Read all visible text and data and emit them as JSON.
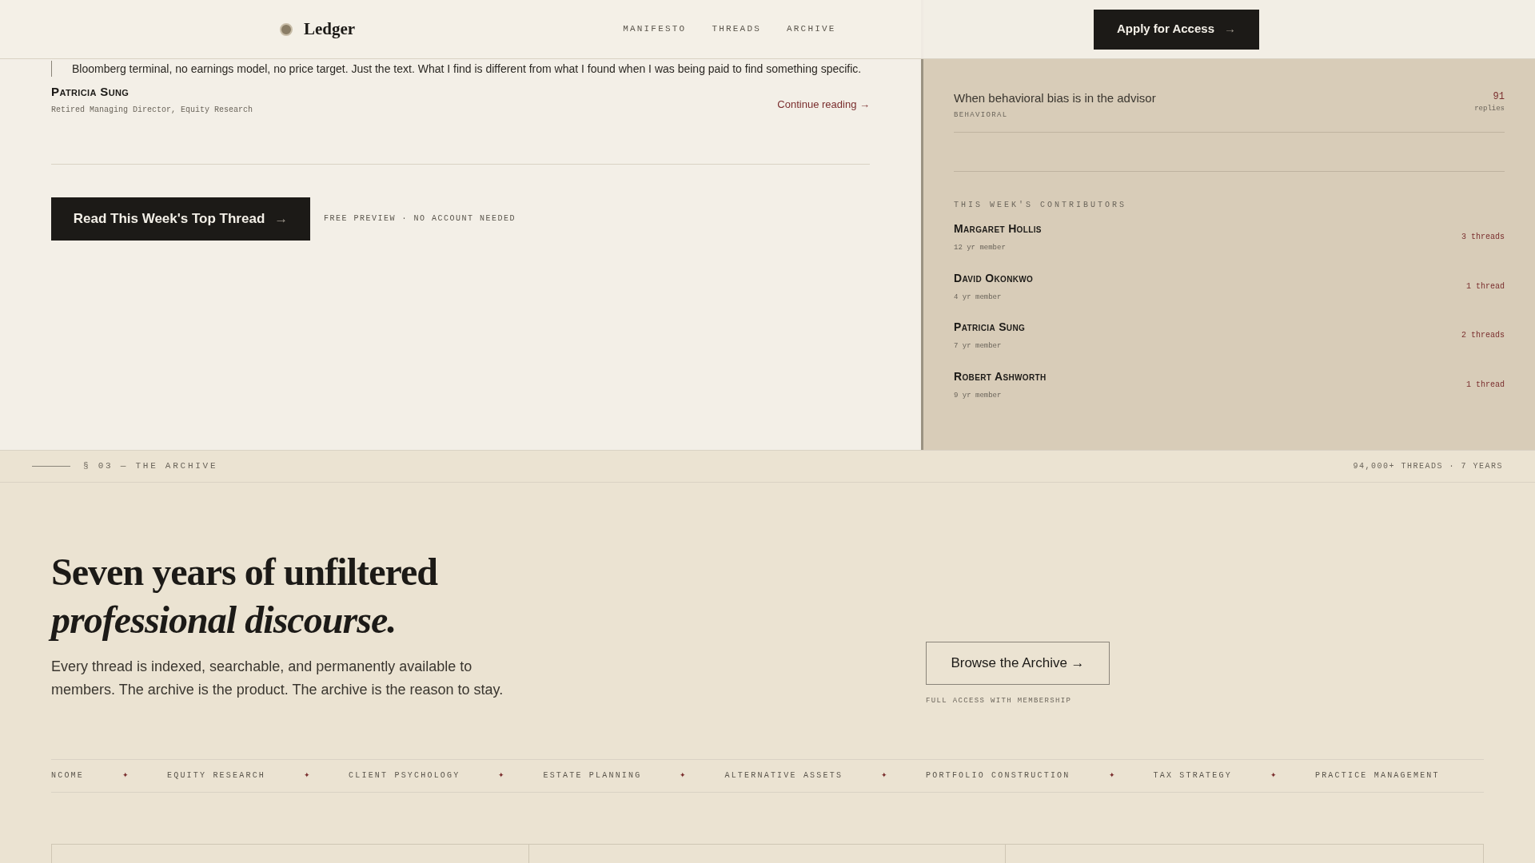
{
  "header": {
    "logo": "Ledger",
    "nav": [
      "MANIFESTO",
      "THREADS",
      "ARCHIVE"
    ],
    "cta": "Apply for Access",
    "cta_arrow": "→"
  },
  "quote": {
    "text": "Bloomberg terminal, no earnings model, no price target. Just the text. What I find is different from what I found when I was being paid to find something specific.",
    "author": "Patricia Sung",
    "role": "Retired Managing Director, Equity Research",
    "link": "Continue reading →"
  },
  "top_thread": {
    "button": "Read This Week's Top Thread",
    "arrow": "→",
    "note": "FREE PREVIEW · NO ACCOUNT NEEDED"
  },
  "sidebar": {
    "thread": {
      "title": "When behavioral bias is in the advisor",
      "tag": "BEHAVIORAL",
      "count": "91",
      "count_label": "replies"
    },
    "contributors_heading": "THIS WEEK'S CONTRIBUTORS",
    "contributors": [
      {
        "name": "Margaret Hollis",
        "tenure": "12 yr member",
        "threads": "3 threads"
      },
      {
        "name": "David Okonkwo",
        "tenure": "4 yr member",
        "threads": "1 thread"
      },
      {
        "name": "Patricia Sung",
        "tenure": "7 yr member",
        "threads": "2 threads"
      },
      {
        "name": "Robert Ashworth",
        "tenure": "9 yr member",
        "threads": "1 thread"
      }
    ]
  },
  "archive": {
    "section": "§ 03 — THE ARCHIVE",
    "stats": "94,000+ THREADS · 7 YEARS",
    "heading": "Seven years of unfiltered",
    "heading_italic": "professional discourse.",
    "body": "Every thread is indexed, searchable, and permanently available to members. The archive is the product. The archive is the reason to stay.",
    "button": "Browse the Archive →",
    "button_note": "FULL ACCESS WITH MEMBERSHIP",
    "topics": [
      "NCOME",
      "EQUITY RESEARCH",
      "CLIENT PSYCHOLOGY",
      "ESTATE PLANNING",
      "ALTERNATIVE ASSETS",
      "PORTFOLIO CONSTRUCTION",
      "TAX STRATEGY",
      "PRACTICE MANAGEMENT"
    ],
    "separator": "✦"
  }
}
